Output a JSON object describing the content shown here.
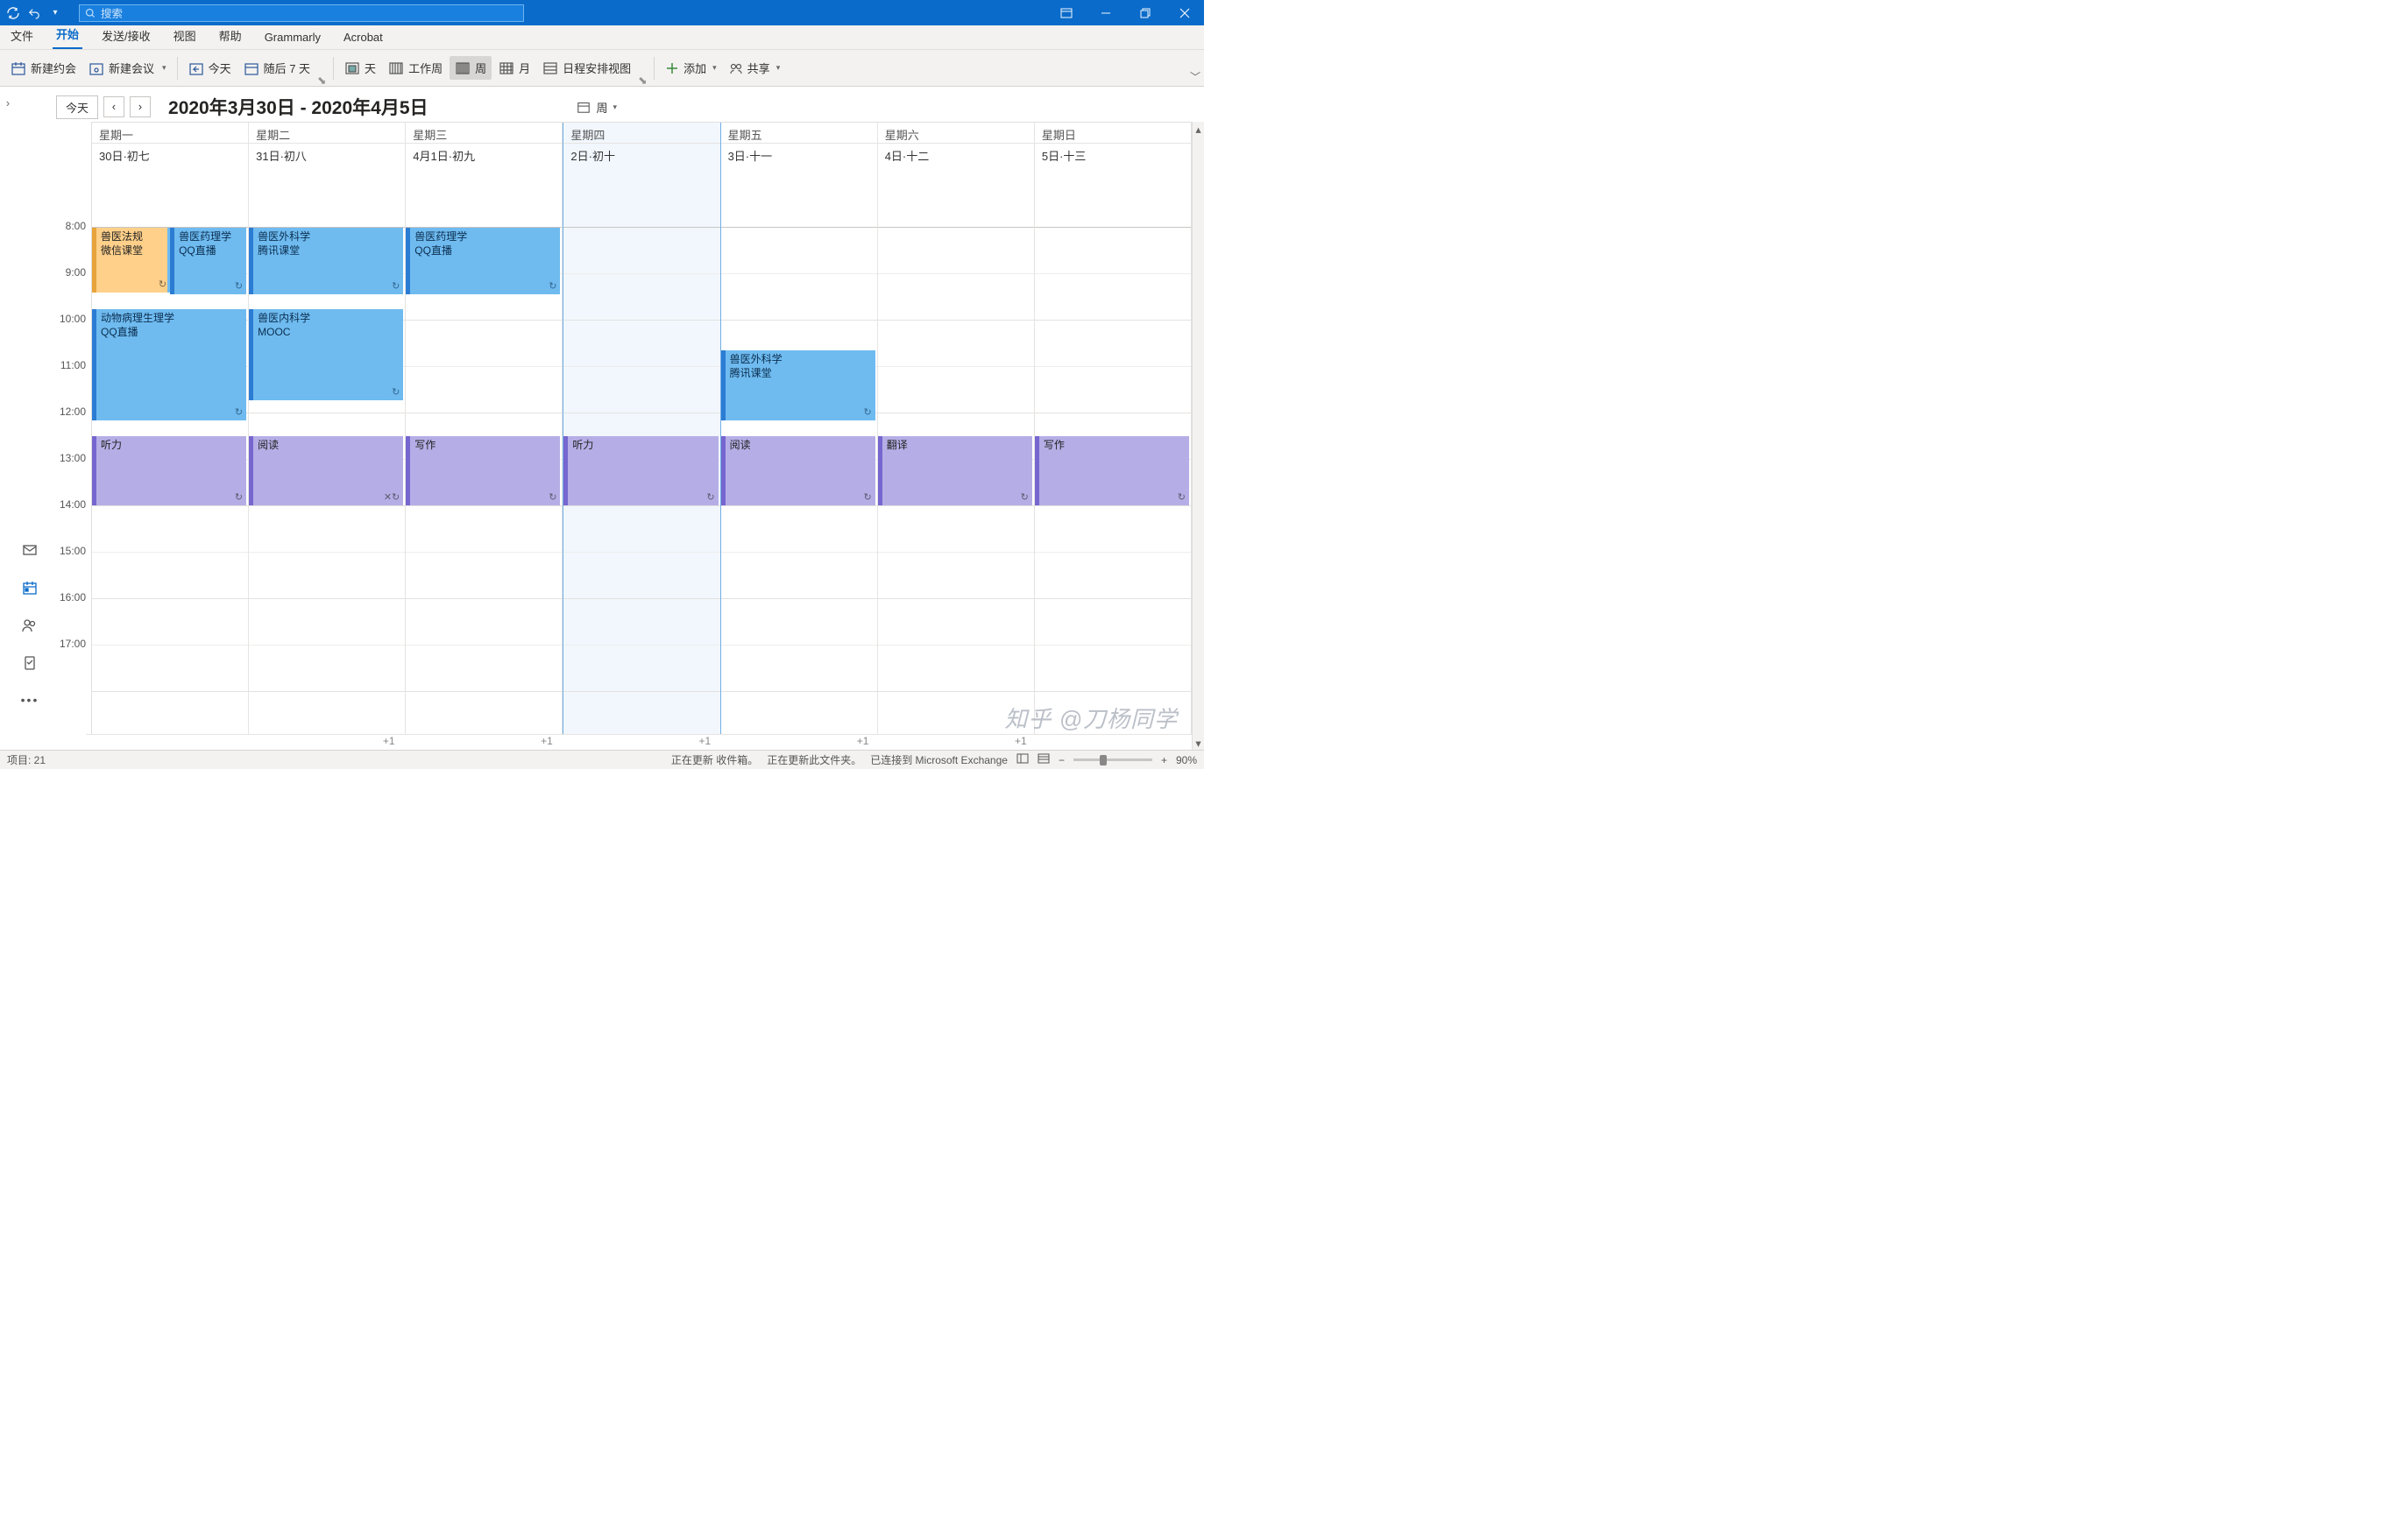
{
  "search": {
    "placeholder": "搜索"
  },
  "tabs": [
    "文件",
    "开始",
    "发送/接收",
    "视图",
    "帮助",
    "Grammarly",
    "Acrobat"
  ],
  "ribbon": {
    "newAppt": "新建约会",
    "newMtg": "新建会议",
    "today": "今天",
    "next7": "随后 7 天",
    "day": "天",
    "workweek": "工作周",
    "week": "周",
    "month": "月",
    "schedule": "日程安排视图",
    "add": "添加",
    "share": "共享"
  },
  "cal": {
    "today": "今天",
    "title": "2020年3月30日 - 2020年4月5日",
    "viewName": "周"
  },
  "dayHeaders": [
    "星期一",
    "星期二",
    "星期三",
    "星期四",
    "星期五",
    "星期六",
    "星期日"
  ],
  "dayDates": [
    "30日·初七",
    "31日·初八",
    "4月1日·初九",
    "2日·初十",
    "3日·十一",
    "4日·十二",
    "5日·十三"
  ],
  "times": [
    "8:00",
    "9:00",
    "10:00",
    "11:00",
    "12:00",
    "13:00",
    "14:00",
    "15:00",
    "16:00",
    "17:00"
  ],
  "events": {
    "mon": {
      "e1t": "兽医法规",
      "e1s": "微信课堂",
      "e2t": "兽医药理学",
      "e2s": "QQ直播",
      "e3t": "动物病理生理学",
      "e3s": "QQ直播",
      "e4t": "听力"
    },
    "tue": {
      "e1t": "兽医外科学",
      "e1s": "腾讯课堂",
      "e2t": "兽医内科学",
      "e2s": "MOOC",
      "e3t": "阅读"
    },
    "wed": {
      "e1t": "兽医药理学",
      "e1s": "QQ直播",
      "e2t": "写作"
    },
    "thu": {
      "e1t": "听力"
    },
    "fri": {
      "e1t": "兽医外科学",
      "e1s": "腾讯课堂",
      "e2t": "阅读"
    },
    "sat": {
      "e1t": "翻译"
    },
    "sun": {
      "e1t": "写作"
    }
  },
  "more": [
    "",
    "+1",
    "+1",
    "+1",
    "+1",
    "+1",
    ""
  ],
  "status": {
    "items": "项目: 21",
    "update1": "正在更新 收件箱。",
    "update2": "正在更新此文件夹。",
    "connected": "已连接到 Microsoft Exchange",
    "zoom": "90%"
  },
  "watermark": "知乎 @刀杨同学"
}
